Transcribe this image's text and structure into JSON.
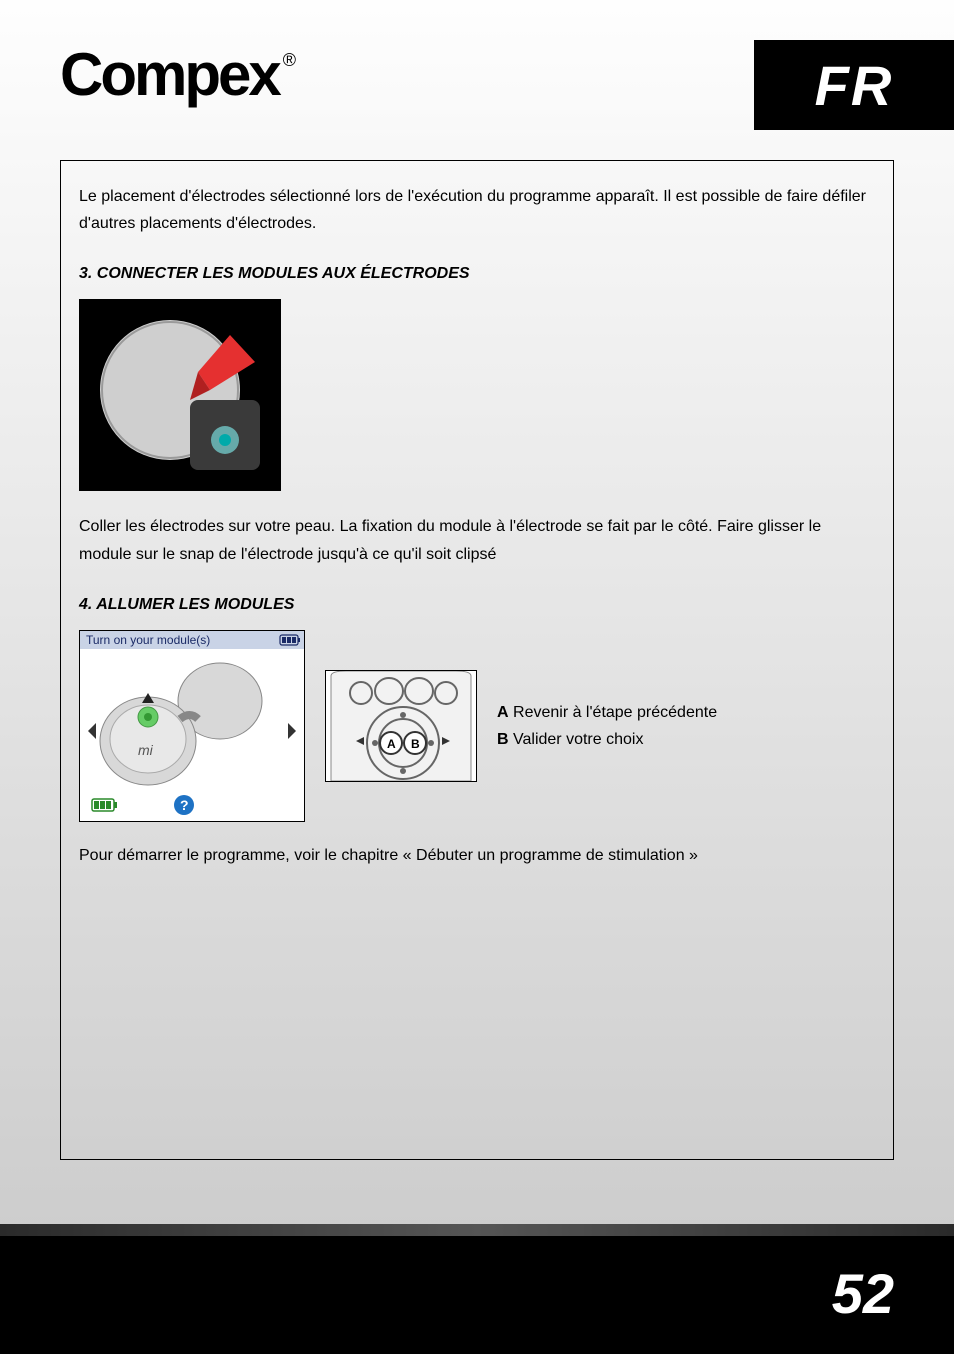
{
  "header": {
    "brand": "Compex",
    "registered": "®",
    "language_tab": "FR"
  },
  "content": {
    "intro_paragraph": "Le placement d'électrodes sélectionné lors de l'exécution du programme apparaît. Il est possible de faire défiler d'autres placements d'électrodes.",
    "section3": {
      "heading": "3.  CONNECTER LES MODULES AUX ÉLECTRODES",
      "paragraph": "Coller les électrodes sur votre peau. La fixation du module à l'électrode se fait par le côté. Faire glisser le module sur le snap de l'électrode jusqu'à ce qu'il soit clipsé"
    },
    "section4": {
      "heading": "4.  ALLUMER LES MODULES",
      "screen_title": "Turn on your module(s)",
      "caption_A_label": "A",
      "caption_A_text": " Revenir à l'étape précédente",
      "caption_B_label": "B",
      "caption_B_text": " Valider votre choix",
      "closing_paragraph": "Pour démarrer le programme, voir le chapitre « Débuter un programme de stimulation »"
    },
    "remote_label_A": "A",
    "remote_label_B": "B",
    "module_label": "mi"
  },
  "footer": {
    "page_number": "52"
  }
}
